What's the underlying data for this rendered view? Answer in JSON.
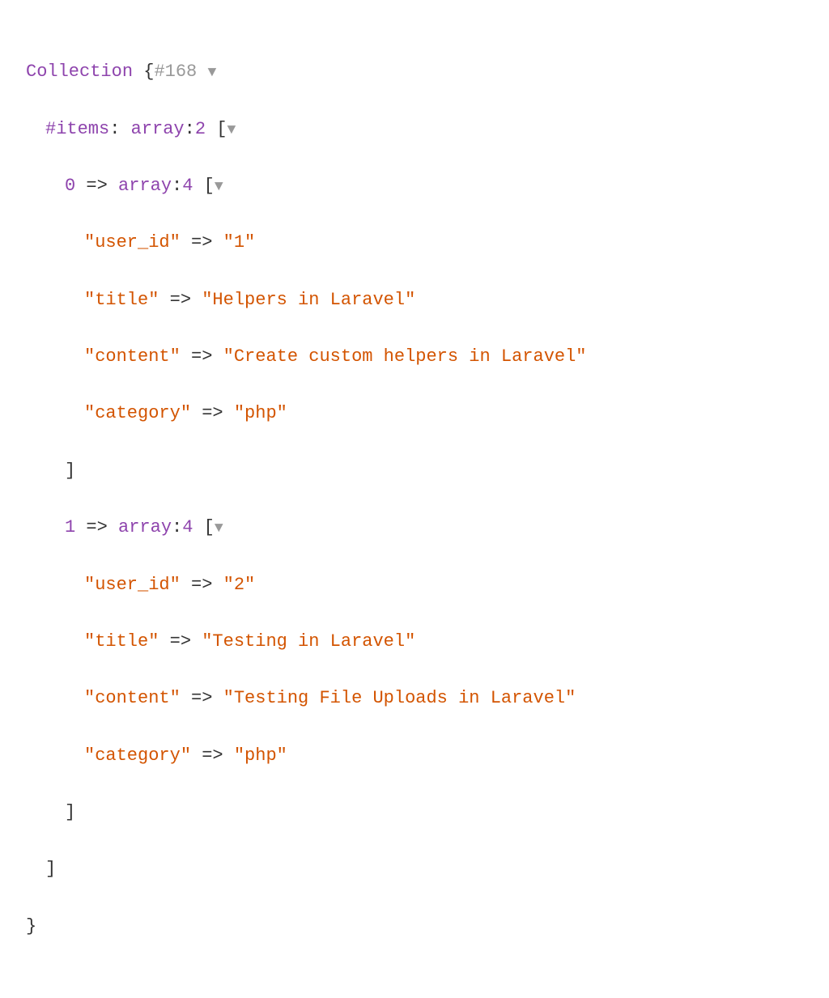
{
  "className": "Collection",
  "objectId": "#168",
  "toggleGlyph": "▼",
  "itemsLabel": "#items",
  "arrayLabel": "array",
  "itemsCount": "2",
  "entries": [
    {
      "index": "0",
      "count": "4",
      "fields": [
        {
          "key": "\"user_id\"",
          "value": "\"1\""
        },
        {
          "key": "\"title\"",
          "value": "\"Helpers in Laravel\""
        },
        {
          "key": "\"content\"",
          "value": "\"Create custom helpers in Laravel\""
        },
        {
          "key": "\"category\"",
          "value": "\"php\""
        }
      ]
    },
    {
      "index": "1",
      "count": "4",
      "fields": [
        {
          "key": "\"user_id\"",
          "value": "\"2\""
        },
        {
          "key": "\"title\"",
          "value": "\"Testing in Laravel\""
        },
        {
          "key": "\"content\"",
          "value": "\"Testing File Uploads in Laravel\""
        },
        {
          "key": "\"category\"",
          "value": "\"php\""
        }
      ]
    }
  ],
  "arrowOp": "=>"
}
